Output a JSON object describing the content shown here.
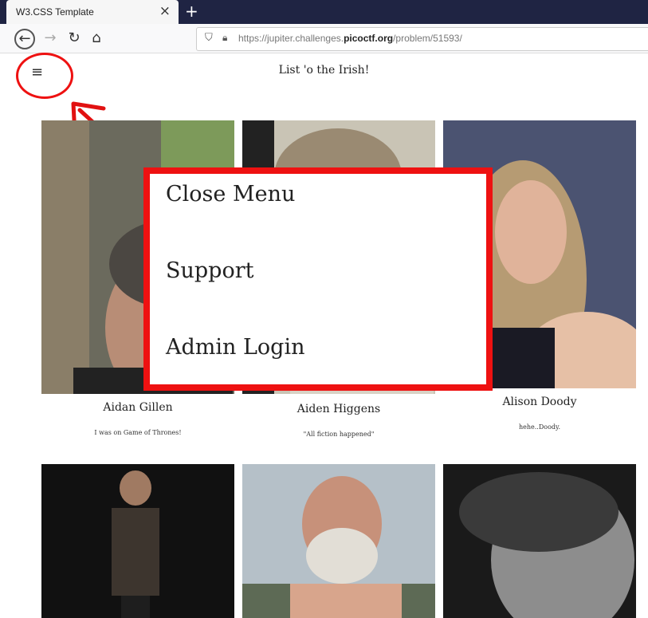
{
  "browser": {
    "tab_title": "W3.CSS Template",
    "tab_close": "×",
    "new_tab": "+",
    "url_prefix": "https://jupiter.challenges.",
    "url_domain": "picoctf.org",
    "url_path": "/problem/51593/"
  },
  "page": {
    "menu_icon": "≡",
    "title": "List 'o the Irish!"
  },
  "menu": {
    "items": [
      "Close Menu",
      "Support",
      "Admin Login"
    ]
  },
  "people": [
    {
      "name": "Aidan Gillen",
      "quote": "I was on Game of Thrones!"
    },
    {
      "name": "Aiden Higgens",
      "quote": "\"All fiction happened\""
    },
    {
      "name": "Alison Doody",
      "quote": "hehe..Doody."
    }
  ],
  "icons": {
    "back": "back-arrow-icon",
    "forward": "forward-arrow-icon",
    "reload": "reload-icon",
    "home": "home-icon",
    "shield": "shield-icon",
    "lock": "lock-icon",
    "hamburger": "hamburger-menu-icon"
  },
  "colors": {
    "annotation_red": "#e11111",
    "tab_strip": "#1f2443"
  }
}
